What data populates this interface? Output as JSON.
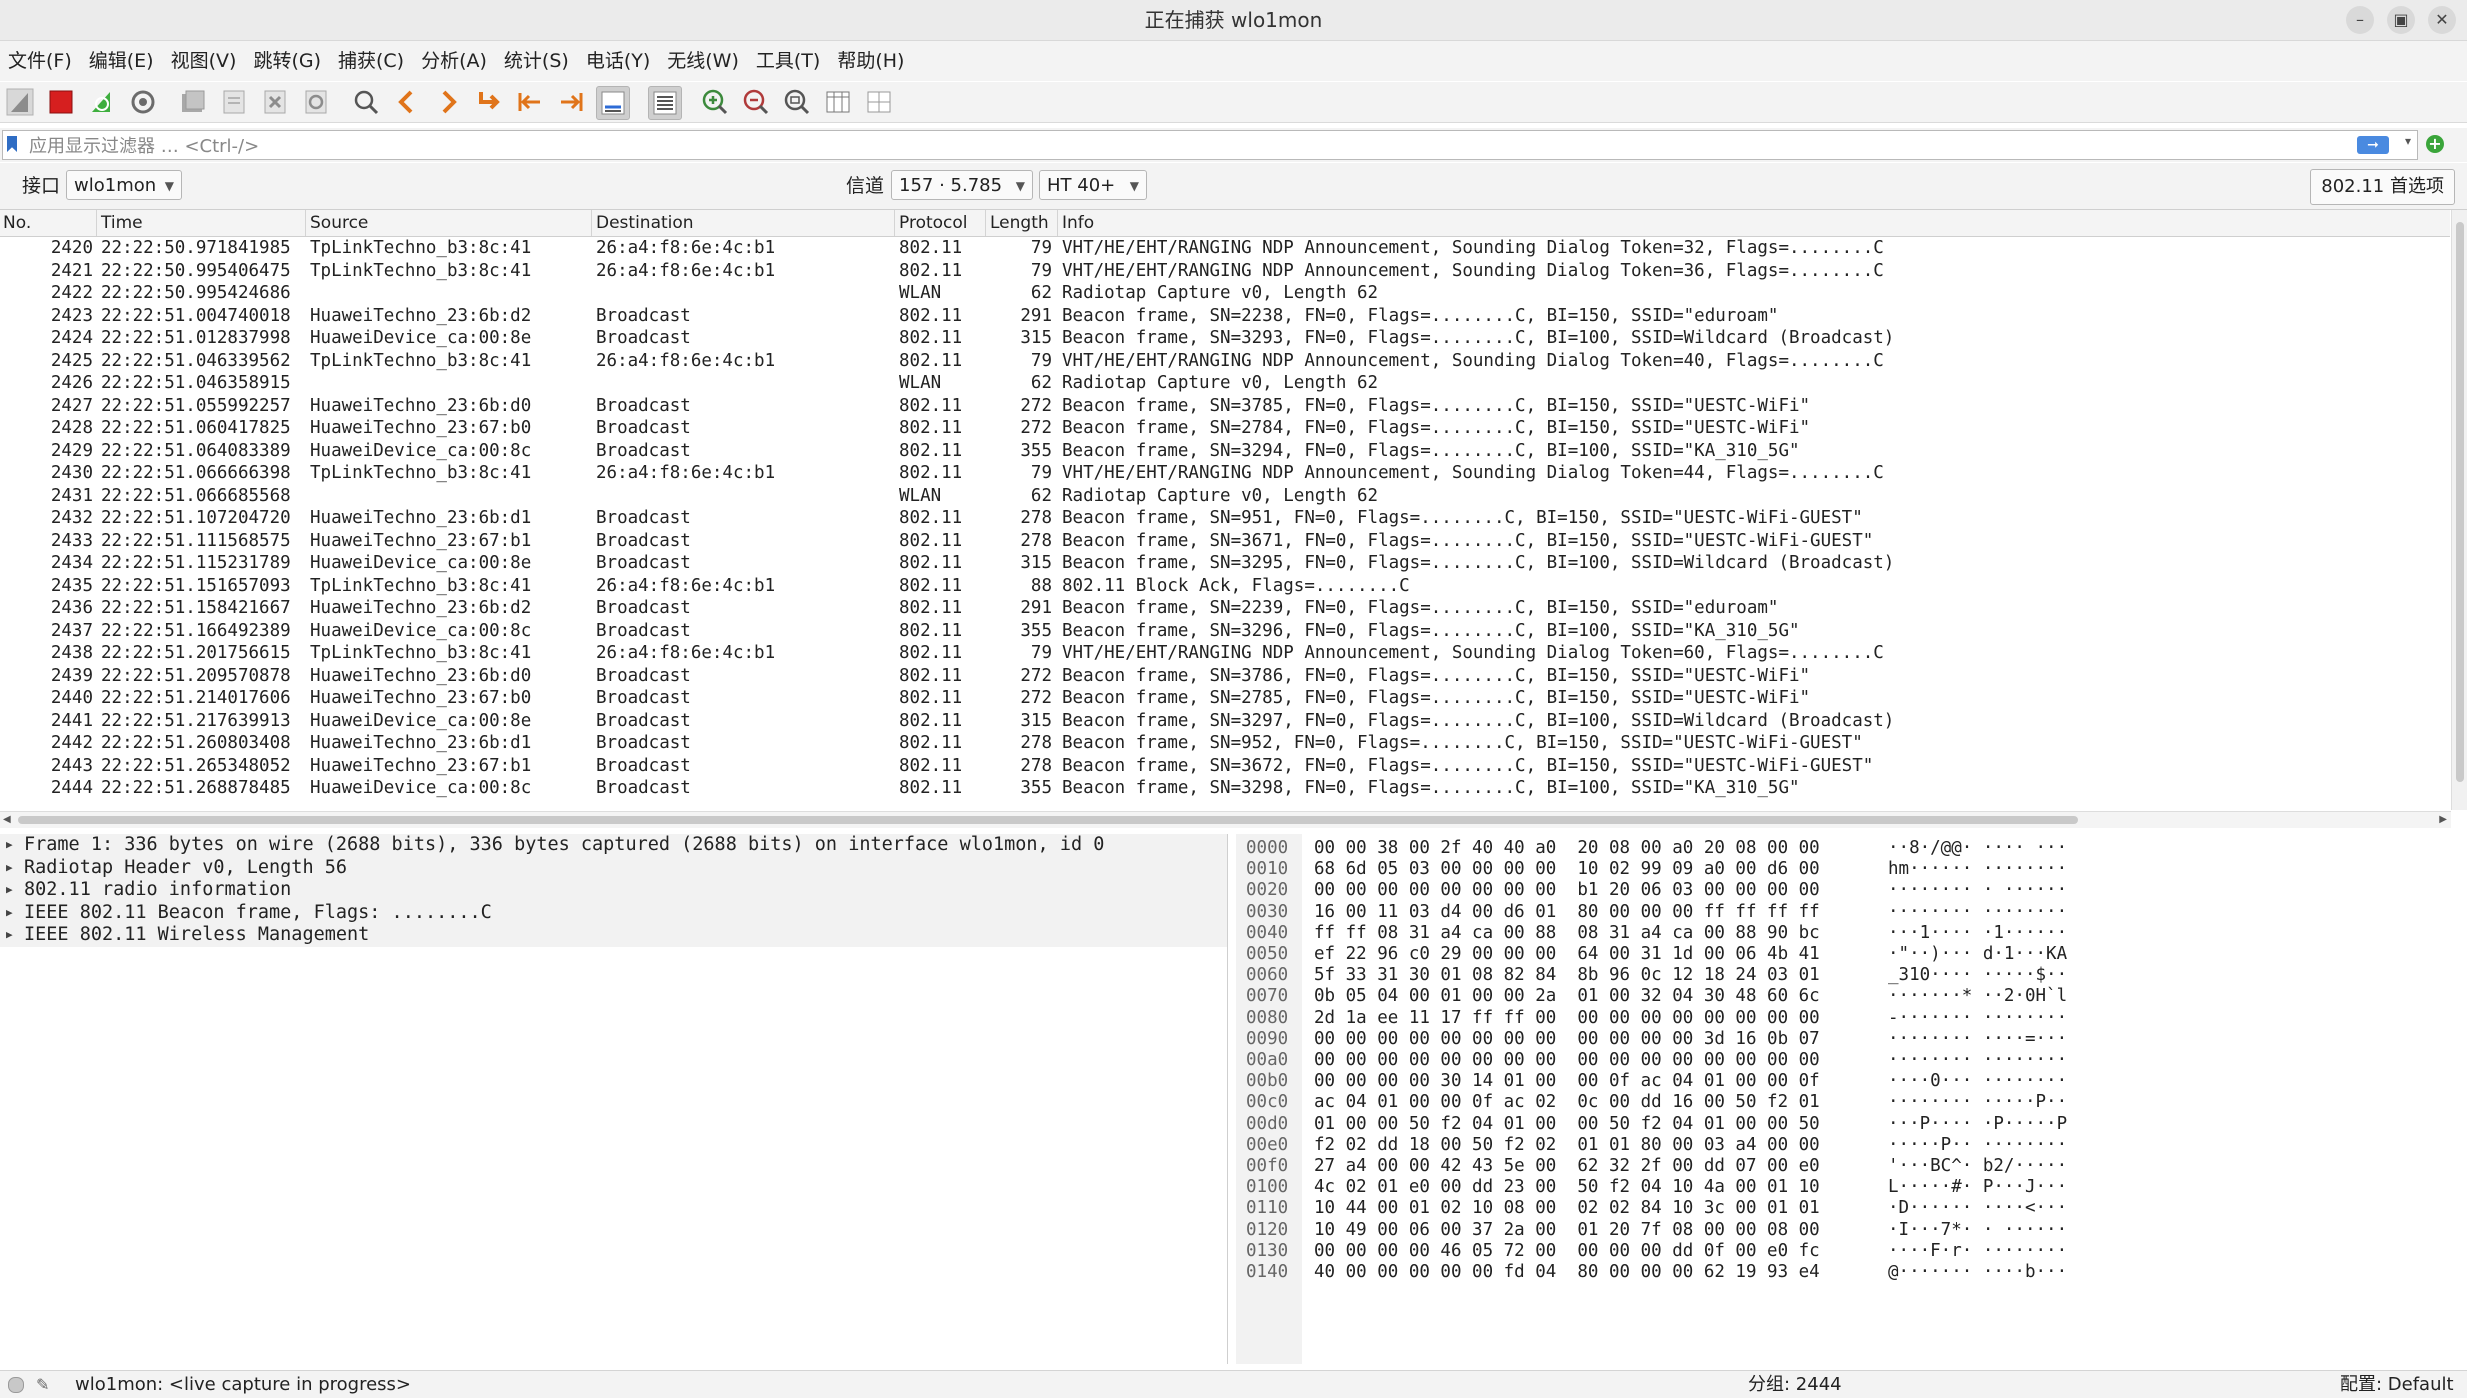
{
  "window": {
    "title": "正在捕获 wlo1mon",
    "buttons": [
      "minimize-icon",
      "maximize-icon",
      "close-icon"
    ]
  },
  "menu": [
    "文件(F)",
    "编辑(E)",
    "视图(V)",
    "跳转(G)",
    "捕获(C)",
    "分析(A)",
    "统计(S)",
    "电话(Y)",
    "无线(W)",
    "工具(T)",
    "帮助(H)"
  ],
  "toolbar": [
    "shark-fin-start-icon",
    "stop-capture-icon",
    "restart-capture-icon",
    "capture-options-icon",
    "open-file-icon",
    "save-file-icon",
    "close-file-icon",
    "reload-file-icon",
    "find-packet-icon",
    "go-back-icon",
    "go-forward-icon",
    "go-to-packet-icon",
    "first-packet-icon",
    "last-packet-icon",
    "autoscroll-icon",
    "colorize-icon",
    "zoom-in-icon",
    "zoom-out-icon",
    "normal-size-icon",
    "resize-columns-icon",
    "layout-icon"
  ],
  "filter": {
    "placeholder": "应用显示过滤器 … <Ctrl-/>"
  },
  "interface_bar": {
    "interface_label": "接口",
    "interface_value": "wlo1mon",
    "channel_label": "信道",
    "channel_value": "157 · 5.785",
    "width_value": "HT 40+",
    "prefs_button": "802.11 首选项"
  },
  "packet_list": {
    "columns": [
      "No.",
      "Time",
      "Source",
      "Destination",
      "Protocol",
      "Length",
      "Info"
    ],
    "rows": [
      [
        "2420",
        "22:22:50.971841985",
        "TpLinkTechno_b3:8c:41",
        "26:a4:f8:6e:4c:b1",
        "802.11",
        "79",
        "VHT/HE/EHT/RANGING NDP Announcement, Sounding Dialog Token=32, Flags=........C"
      ],
      [
        "2421",
        "22:22:50.995406475",
        "TpLinkTechno_b3:8c:41",
        "26:a4:f8:6e:4c:b1",
        "802.11",
        "79",
        "VHT/HE/EHT/RANGING NDP Announcement, Sounding Dialog Token=36, Flags=........C"
      ],
      [
        "2422",
        "22:22:50.995424686",
        "",
        "",
        "WLAN",
        "62",
        "Radiotap Capture v0, Length 62"
      ],
      [
        "2423",
        "22:22:51.004740018",
        "HuaweiTechno_23:6b:d2",
        "Broadcast",
        "802.11",
        "291",
        "Beacon frame, SN=2238, FN=0, Flags=........C, BI=150, SSID=\"eduroam\""
      ],
      [
        "2424",
        "22:22:51.012837998",
        "HuaweiDevice_ca:00:8e",
        "Broadcast",
        "802.11",
        "315",
        "Beacon frame, SN=3293, FN=0, Flags=........C, BI=100, SSID=Wildcard (Broadcast)"
      ],
      [
        "2425",
        "22:22:51.046339562",
        "TpLinkTechno_b3:8c:41",
        "26:a4:f8:6e:4c:b1",
        "802.11",
        "79",
        "VHT/HE/EHT/RANGING NDP Announcement, Sounding Dialog Token=40, Flags=........C"
      ],
      [
        "2426",
        "22:22:51.046358915",
        "",
        "",
        "WLAN",
        "62",
        "Radiotap Capture v0, Length 62"
      ],
      [
        "2427",
        "22:22:51.055992257",
        "HuaweiTechno_23:6b:d0",
        "Broadcast",
        "802.11",
        "272",
        "Beacon frame, SN=3785, FN=0, Flags=........C, BI=150, SSID=\"UESTC-WiFi\""
      ],
      [
        "2428",
        "22:22:51.060417825",
        "HuaweiTechno_23:67:b0",
        "Broadcast",
        "802.11",
        "272",
        "Beacon frame, SN=2784, FN=0, Flags=........C, BI=150, SSID=\"UESTC-WiFi\""
      ],
      [
        "2429",
        "22:22:51.064083389",
        "HuaweiDevice_ca:00:8c",
        "Broadcast",
        "802.11",
        "355",
        "Beacon frame, SN=3294, FN=0, Flags=........C, BI=100, SSID=\"KA_310_5G\""
      ],
      [
        "2430",
        "22:22:51.066666398",
        "TpLinkTechno_b3:8c:41",
        "26:a4:f8:6e:4c:b1",
        "802.11",
        "79",
        "VHT/HE/EHT/RANGING NDP Announcement, Sounding Dialog Token=44, Flags=........C"
      ],
      [
        "2431",
        "22:22:51.066685568",
        "",
        "",
        "WLAN",
        "62",
        "Radiotap Capture v0, Length 62"
      ],
      [
        "2432",
        "22:22:51.107204720",
        "HuaweiTechno_23:6b:d1",
        "Broadcast",
        "802.11",
        "278",
        "Beacon frame, SN=951, FN=0, Flags=........C, BI=150, SSID=\"UESTC-WiFi-GUEST\""
      ],
      [
        "2433",
        "22:22:51.111568575",
        "HuaweiTechno_23:67:b1",
        "Broadcast",
        "802.11",
        "278",
        "Beacon frame, SN=3671, FN=0, Flags=........C, BI=150, SSID=\"UESTC-WiFi-GUEST\""
      ],
      [
        "2434",
        "22:22:51.115231789",
        "HuaweiDevice_ca:00:8e",
        "Broadcast",
        "802.11",
        "315",
        "Beacon frame, SN=3295, FN=0, Flags=........C, BI=100, SSID=Wildcard (Broadcast)"
      ],
      [
        "2435",
        "22:22:51.151657093",
        "TpLinkTechno_b3:8c:41",
        "26:a4:f8:6e:4c:b1",
        "802.11",
        "88",
        "802.11 Block Ack, Flags=........C"
      ],
      [
        "2436",
        "22:22:51.158421667",
        "HuaweiTechno_23:6b:d2",
        "Broadcast",
        "802.11",
        "291",
        "Beacon frame, SN=2239, FN=0, Flags=........C, BI=150, SSID=\"eduroam\""
      ],
      [
        "2437",
        "22:22:51.166492389",
        "HuaweiDevice_ca:00:8c",
        "Broadcast",
        "802.11",
        "355",
        "Beacon frame, SN=3296, FN=0, Flags=........C, BI=100, SSID=\"KA_310_5G\""
      ],
      [
        "2438",
        "22:22:51.201756615",
        "TpLinkTechno_b3:8c:41",
        "26:a4:f8:6e:4c:b1",
        "802.11",
        "79",
        "VHT/HE/EHT/RANGING NDP Announcement, Sounding Dialog Token=60, Flags=........C"
      ],
      [
        "2439",
        "22:22:51.209570878",
        "HuaweiTechno_23:6b:d0",
        "Broadcast",
        "802.11",
        "272",
        "Beacon frame, SN=3786, FN=0, Flags=........C, BI=150, SSID=\"UESTC-WiFi\""
      ],
      [
        "2440",
        "22:22:51.214017606",
        "HuaweiTechno_23:67:b0",
        "Broadcast",
        "802.11",
        "272",
        "Beacon frame, SN=2785, FN=0, Flags=........C, BI=150, SSID=\"UESTC-WiFi\""
      ],
      [
        "2441",
        "22:22:51.217639913",
        "HuaweiDevice_ca:00:8e",
        "Broadcast",
        "802.11",
        "315",
        "Beacon frame, SN=3297, FN=0, Flags=........C, BI=100, SSID=Wildcard (Broadcast)"
      ],
      [
        "2442",
        "22:22:51.260803408",
        "HuaweiTechno_23:6b:d1",
        "Broadcast",
        "802.11",
        "278",
        "Beacon frame, SN=952, FN=0, Flags=........C, BI=150, SSID=\"UESTC-WiFi-GUEST\""
      ],
      [
        "2443",
        "22:22:51.265348052",
        "HuaweiTechno_23:67:b1",
        "Broadcast",
        "802.11",
        "278",
        "Beacon frame, SN=3672, FN=0, Flags=........C, BI=150, SSID=\"UESTC-WiFi-GUEST\""
      ],
      [
        "2444",
        "22:22:51.268878485",
        "HuaweiDevice_ca:00:8c",
        "Broadcast",
        "802.11",
        "355",
        "Beacon frame, SN=3298, FN=0, Flags=........C, BI=100, SSID=\"KA_310_5G\""
      ]
    ]
  },
  "details": [
    "Frame 1: 336 bytes on wire (2688 bits), 336 bytes captured (2688 bits) on interface wlo1mon, id 0",
    "Radiotap Header v0, Length 56",
    "802.11 radio information",
    "IEEE 802.11 Beacon frame, Flags: ........C",
    "IEEE 802.11 Wireless Management"
  ],
  "bytes": [
    [
      "0000",
      "00 00 38 00 2f 40 40 a0  20 08 00 a0 20 08 00 00",
      "··8·/@@· ···· ···"
    ],
    [
      "0010",
      "68 6d 05 03 00 00 00 00  10 02 99 09 a0 00 d6 00",
      "hm······ ········"
    ],
    [
      "0020",
      "00 00 00 00 00 00 00 00  b1 20 06 03 00 00 00 00",
      "········ · ······"
    ],
    [
      "0030",
      "16 00 11 03 d4 00 d6 01  80 00 00 00 ff ff ff ff",
      "········ ········"
    ],
    [
      "0040",
      "ff ff 08 31 a4 ca 00 88  08 31 a4 ca 00 88 90 bc",
      "···1···· ·1······"
    ],
    [
      "0050",
      "ef 22 96 c0 29 00 00 00  64 00 31 1d 00 06 4b 41",
      "·\"··)··· d·1···KA"
    ],
    [
      "0060",
      "5f 33 31 30 01 08 82 84  8b 96 0c 12 18 24 03 01",
      "_310···· ·····$··"
    ],
    [
      "0070",
      "0b 05 04 00 01 00 00 2a  01 00 32 04 30 48 60 6c",
      "·······* ··2·0H`l"
    ],
    [
      "0080",
      "2d 1a ee 11 17 ff ff 00  00 00 00 00 00 00 00 00",
      "-······· ········"
    ],
    [
      "0090",
      "00 00 00 00 00 00 00 00  00 00 00 00 3d 16 0b 07",
      "········ ····=···"
    ],
    [
      "00a0",
      "00 00 00 00 00 00 00 00  00 00 00 00 00 00 00 00",
      "········ ········"
    ],
    [
      "00b0",
      "00 00 00 00 30 14 01 00  00 0f ac 04 01 00 00 0f",
      "····0··· ········"
    ],
    [
      "00c0",
      "ac 04 01 00 00 0f ac 02  0c 00 dd 16 00 50 f2 01",
      "········ ·····P··"
    ],
    [
      "00d0",
      "01 00 00 50 f2 04 01 00  00 50 f2 04 01 00 00 50",
      "···P···· ·P·····P"
    ],
    [
      "00e0",
      "f2 02 dd 18 00 50 f2 02  01 01 80 00 03 a4 00 00",
      "·····P·· ········"
    ],
    [
      "00f0",
      "27 a4 00 00 42 43 5e 00  62 32 2f 00 dd 07 00 e0",
      "'···BC^· b2/·····"
    ],
    [
      "0100",
      "4c 02 01 e0 00 dd 23 00  50 f2 04 10 4a 00 01 10",
      "L·····#· P···J···"
    ],
    [
      "0110",
      "10 44 00 01 02 10 08 00  02 02 84 10 3c 00 01 01",
      "·D······ ····<···"
    ],
    [
      "0120",
      "10 49 00 06 00 37 2a 00  01 20 7f 08 00 00 08 00",
      "·I···7*· · ······"
    ],
    [
      "0130",
      "00 00 00 00 46 05 72 00  00 00 00 dd 0f 00 e0 fc",
      "····F·r· ········"
    ],
    [
      "0140",
      "40 00 00 00 00 00 fd 04  80 00 00 00 62 19 93 e4",
      "@······· ····b···"
    ]
  ],
  "status": {
    "capture_text": "wlo1mon: <live capture in progress>",
    "packets_text": "分组: 2444",
    "profile_text": "配置: Default"
  }
}
